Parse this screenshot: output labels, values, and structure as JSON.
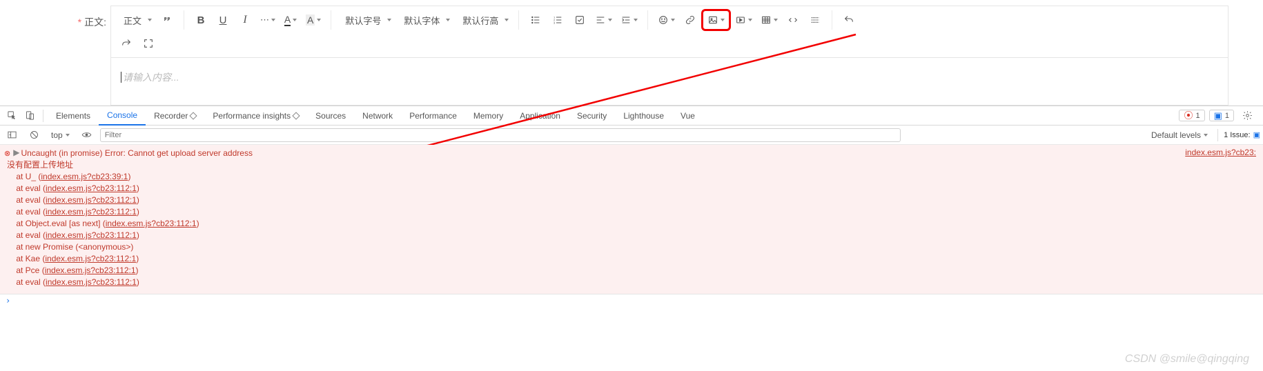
{
  "editor": {
    "label": "正文:",
    "required": "*",
    "placeholder": "请输入内容...",
    "toolbar": {
      "paragraph": "正文",
      "fontSize": "默认字号",
      "fontFamily": "默认字体",
      "lineHeight": "默认行高"
    }
  },
  "devtools": {
    "tabs": {
      "elements": "Elements",
      "console": "Console",
      "recorder": "Recorder",
      "perfInsights": "Performance insights",
      "sources": "Sources",
      "network": "Network",
      "performance": "Performance",
      "memory": "Memory",
      "application": "Application",
      "security": "Security",
      "lighthouse": "Lighthouse",
      "vue": "Vue"
    },
    "errBadge": "1",
    "msgBadge": "1",
    "sub": {
      "top": "top",
      "filter": "Filter",
      "levels": "Default levels",
      "issues": "1 Issue:"
    },
    "console": {
      "errLine": "Uncaught (in promise) Error: Cannot get upload server address",
      "zh": "没有配置上传地址",
      "src": "index.esm.js?cb23:",
      "stack": [
        {
          "pre": "    at U_ (",
          "link": "index.esm.js?cb23:39:1",
          "post": ")"
        },
        {
          "pre": "    at eval (",
          "link": "index.esm.js?cb23:112:1",
          "post": ")"
        },
        {
          "pre": "    at eval (",
          "link": "index.esm.js?cb23:112:1",
          "post": ")"
        },
        {
          "pre": "    at eval (",
          "link": "index.esm.js?cb23:112:1",
          "post": ")"
        },
        {
          "pre": "    at Object.eval [as next] (",
          "link": "index.esm.js?cb23:112:1",
          "post": ")"
        },
        {
          "pre": "    at eval (",
          "link": "index.esm.js?cb23:112:1",
          "post": ")"
        },
        {
          "pre": "    at new Promise (<anonymous>)",
          "link": "",
          "post": ""
        },
        {
          "pre": "    at Kae (",
          "link": "index.esm.js?cb23:112:1",
          "post": ")"
        },
        {
          "pre": "    at Pce (",
          "link": "index.esm.js?cb23:112:1",
          "post": ")"
        },
        {
          "pre": "    at eval (",
          "link": "index.esm.js?cb23:112:1",
          "post": ")"
        }
      ]
    }
  },
  "watermark": "CSDN @smile@qingqing"
}
